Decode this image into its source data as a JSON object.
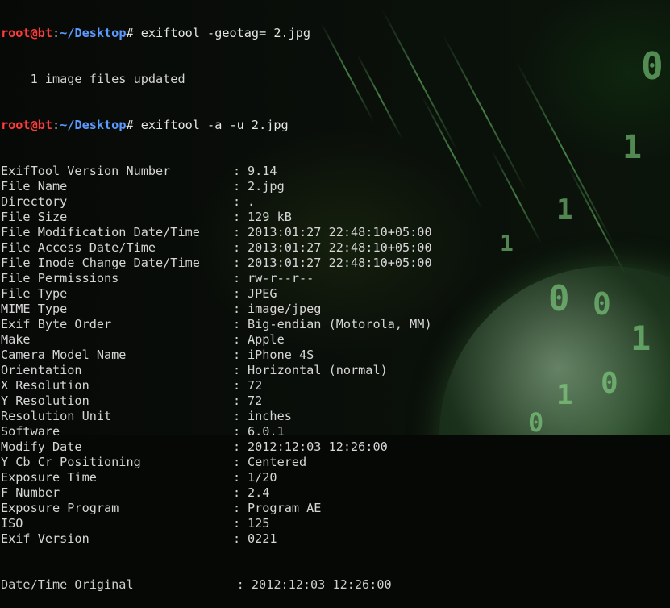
{
  "prompts": [
    {
      "user": "root@bt",
      "separator": ":",
      "path": "~/Desktop",
      "symbol": "#",
      "command": " exiftool -geotag= 2.jpg"
    },
    {
      "user": "root@bt",
      "separator": ":",
      "path": "~/Desktop",
      "symbol": "#",
      "command": " exiftool -a -u 2.jpg"
    }
  ],
  "geotag_output": "    1 image files updated",
  "exif_rows": [
    {
      "key": "ExifTool Version Number",
      "value": "9.14"
    },
    {
      "key": "File Name",
      "value": "2.jpg"
    },
    {
      "key": "Directory",
      "value": "."
    },
    {
      "key": "File Size",
      "value": "129 kB"
    },
    {
      "key": "File Modification Date/Time",
      "value": "2013:01:27 22:48:10+05:00"
    },
    {
      "key": "File Access Date/Time",
      "value": "2013:01:27 22:48:10+05:00"
    },
    {
      "key": "File Inode Change Date/Time",
      "value": "2013:01:27 22:48:10+05:00"
    },
    {
      "key": "File Permissions",
      "value": "rw-r--r--"
    },
    {
      "key": "File Type",
      "value": "JPEG"
    },
    {
      "key": "MIME Type",
      "value": "image/jpeg"
    },
    {
      "key": "Exif Byte Order",
      "value": "Big-endian (Motorola, MM)"
    },
    {
      "key": "Make",
      "value": "Apple"
    },
    {
      "key": "Camera Model Name",
      "value": "iPhone 4S"
    },
    {
      "key": "Orientation",
      "value": "Horizontal (normal)"
    },
    {
      "key": "X Resolution",
      "value": "72"
    },
    {
      "key": "Y Resolution",
      "value": "72"
    },
    {
      "key": "Resolution Unit",
      "value": "inches"
    },
    {
      "key": "Software",
      "value": "6.0.1"
    },
    {
      "key": "Modify Date",
      "value": "2012:12:03 12:26:00"
    },
    {
      "key": "Y Cb Cr Positioning",
      "value": "Centered"
    },
    {
      "key": "Exposure Time",
      "value": "1/20"
    },
    {
      "key": "F Number",
      "value": "2.4"
    },
    {
      "key": "Exposure Program",
      "value": "Program AE"
    },
    {
      "key": "ISO",
      "value": "125"
    },
    {
      "key": "Exif Version",
      "value": "0221"
    }
  ],
  "field_separator": ": ",
  "partial_last_row": "Date/Time Original              : 2012:12:03 12:26:00",
  "wallpaper_digits": [
    "0",
    "1",
    "1",
    "0",
    "0",
    "1",
    "0",
    "1",
    "0",
    "1"
  ],
  "colors": {
    "prompt_user": "#ff3b3b",
    "prompt_path": "#5b9bff",
    "text": "#dcdcdc",
    "background": "#050805",
    "matrix_green": "#8ce68c"
  }
}
